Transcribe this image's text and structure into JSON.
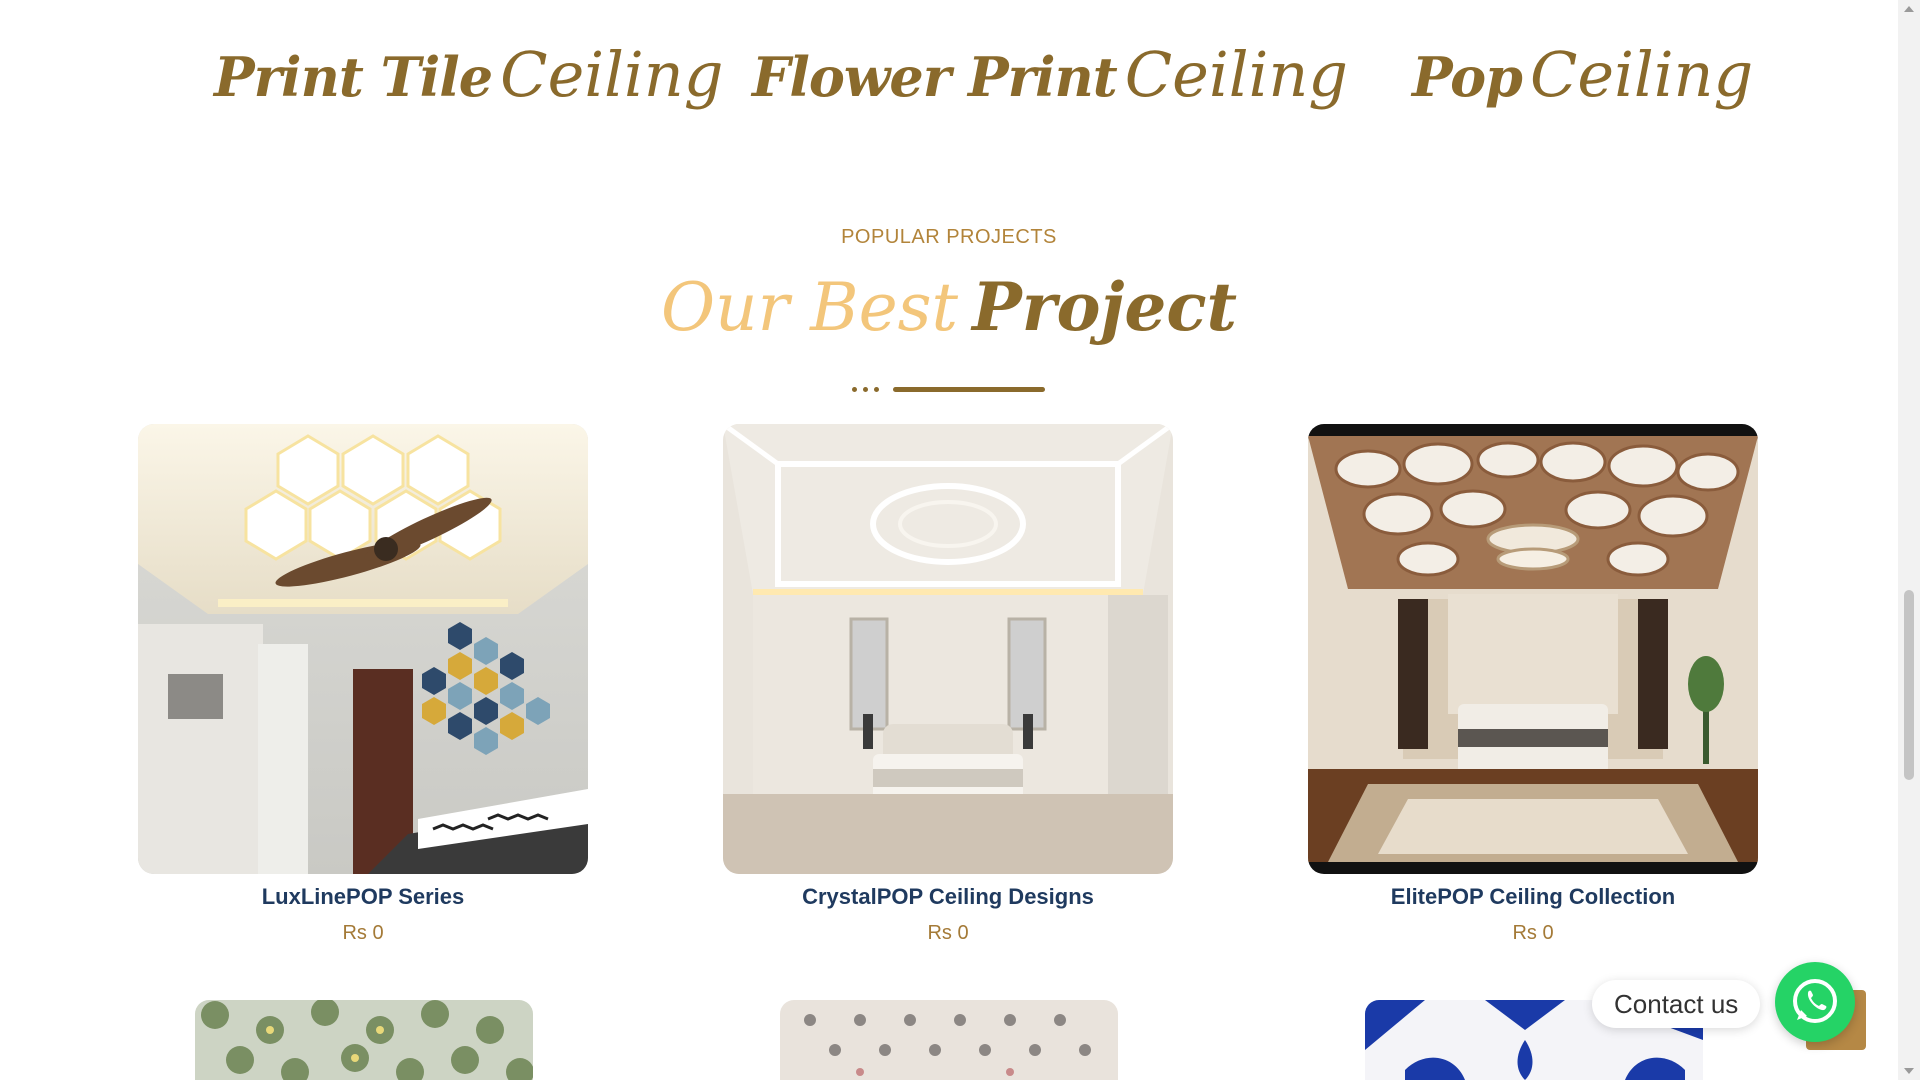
{
  "categories": [
    {
      "bold": "Print Tile",
      "thin": "Ceiling"
    },
    {
      "bold": "Flower Print",
      "thin": "Ceiling"
    },
    {
      "bold": "Pop",
      "thin": "Ceiling"
    }
  ],
  "section": {
    "eyebrow": "POPULAR PROJECTS",
    "title_light": "Our Best",
    "title_dark": "Project"
  },
  "products": [
    {
      "name": "LuxLinePOP Series",
      "price": "Rs 0"
    },
    {
      "name": "CrystalPOP Ceiling Designs",
      "price": "Rs 0"
    },
    {
      "name": "ElitePOP Ceiling Collection",
      "price": "Rs 0"
    }
  ],
  "widgets": {
    "contact_label": "Contact us",
    "whatsapp_icon": "whatsapp-icon",
    "scroll_top_icon": "scroll-to-top-icon"
  },
  "colors": {
    "accent_brown": "#8a6a2c",
    "accent_gold": "#b2843a",
    "title_light": "#f3c67b",
    "product_name": "#1f3a5f",
    "whatsapp_green": "#25d366"
  }
}
